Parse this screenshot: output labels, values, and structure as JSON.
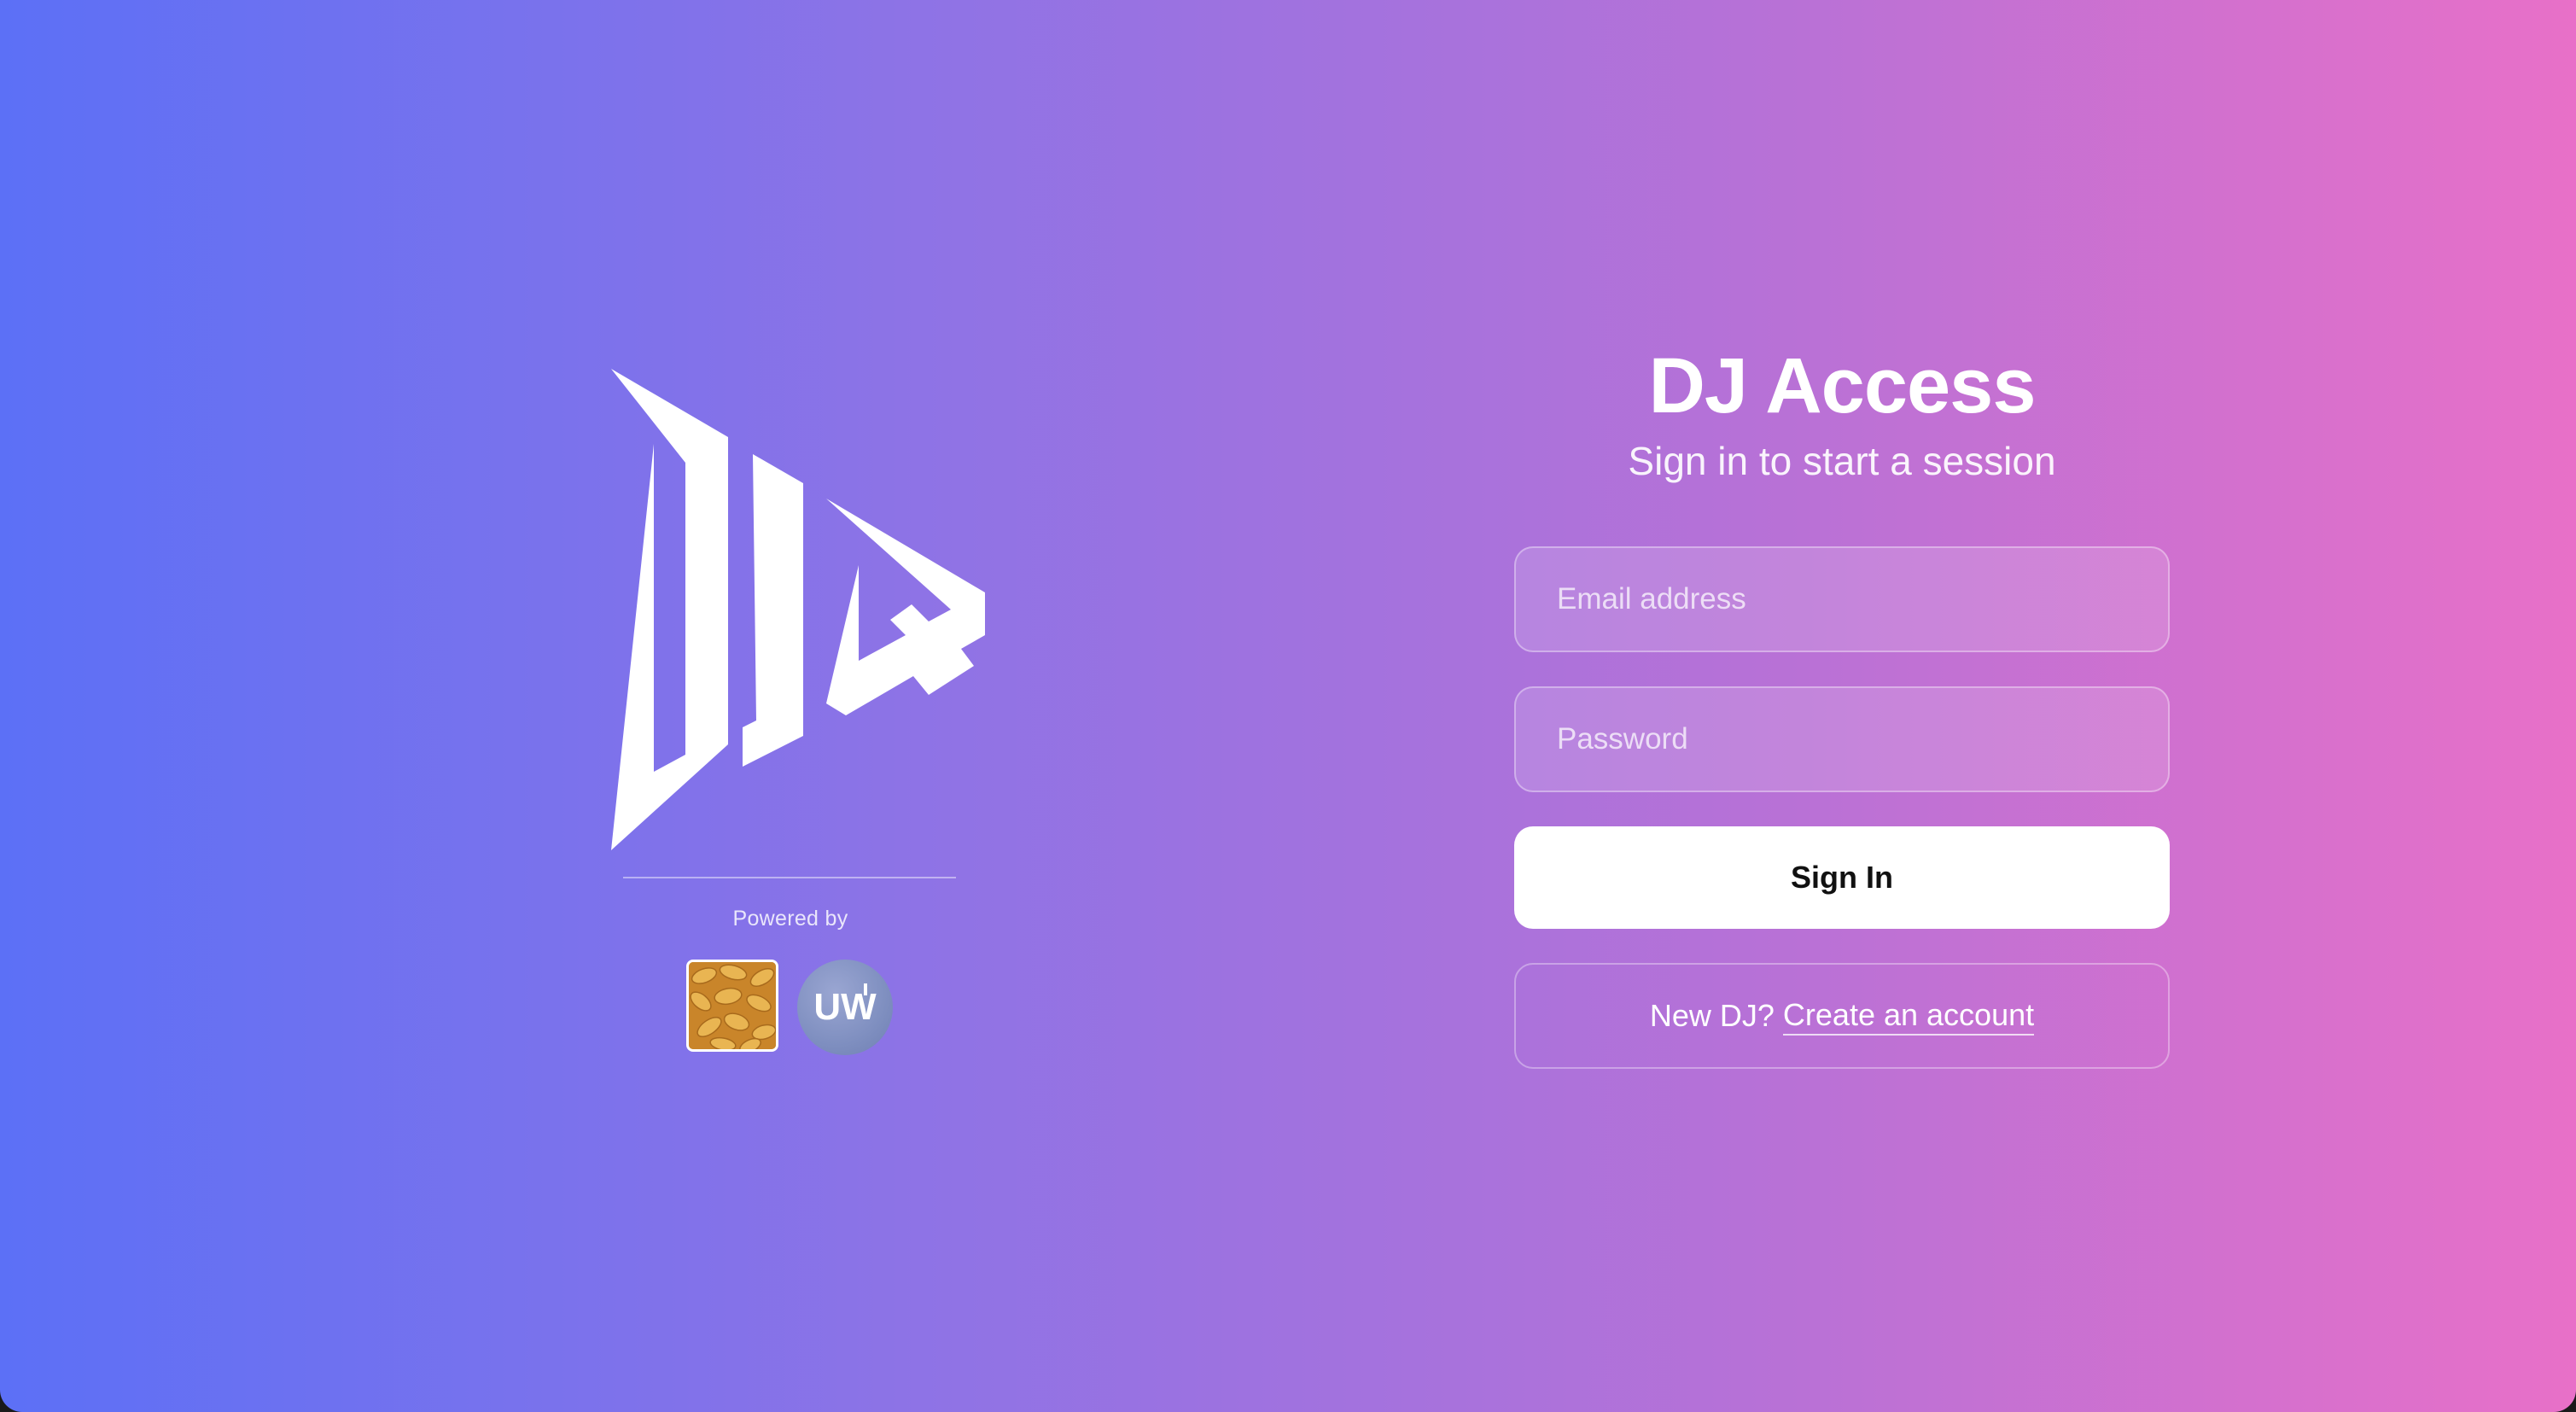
{
  "brand": {
    "logo_icon": "djq-logo-icon",
    "powered_by_label": "Powered by",
    "partners": [
      {
        "name": "peanut-logo-icon"
      },
      {
        "name": "uw-logo-icon",
        "text": "UW"
      }
    ]
  },
  "login": {
    "title": "DJ Access",
    "subtitle": "Sign in to start a session",
    "email_placeholder": "Email address",
    "password_placeholder": "Password",
    "sign_in_label": "Sign In",
    "signup_prompt": "New DJ?",
    "signup_link": "Create an account"
  },
  "colors": {
    "gradient_start": "#5c70f6",
    "gradient_mid": "#a773da",
    "gradient_end": "#e870c8",
    "button_bg": "#ffffff",
    "button_text": "#111111"
  }
}
